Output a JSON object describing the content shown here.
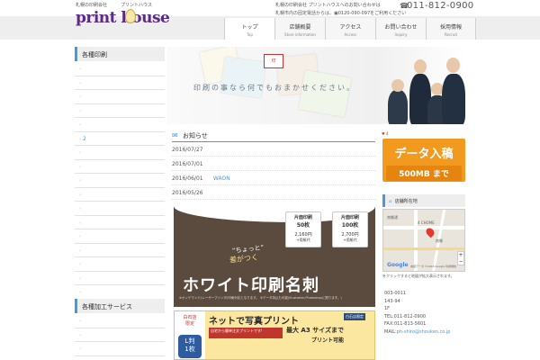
{
  "header": {
    "logo_tagline": "札幌の印刷会社",
    "logo_kana": "プリントハウス",
    "logo_text": "print house",
    "contact_line1": "札幌の印刷会社 プリントハウスへのお問い合わせは",
    "tel_icon": "☎",
    "tel_number": "011-812-0900",
    "contact_line2": "札幌市内の固定電話からは、▣0120-090-097をご利用ください"
  },
  "nav": [
    {
      "jp": "トップ",
      "en": "Top"
    },
    {
      "jp": "店舗概要",
      "en": "Store information"
    },
    {
      "jp": "アクセス",
      "en": "Access"
    },
    {
      "jp": "お問い合わせ",
      "en": "Inquiry"
    },
    {
      "jp": "採用情報",
      "en": "Recruit"
    }
  ],
  "sidebar": {
    "heading1": "各種印刷",
    "items1": [
      "",
      "",
      "",
      "",
      "",
      "2",
      "",
      "",
      "",
      "",
      "",
      "",
      "",
      "",
      "",
      "",
      "",
      ""
    ],
    "heading2": "各種加工サービス",
    "chevron": "›"
  },
  "hero": {
    "stamp_text": "印",
    "tagline": "印刷の事なら何でもおまかせください。"
  },
  "news": {
    "icon": "✉",
    "title": "お知らせ",
    "rows": [
      {
        "date": "2016/07/27",
        "text": ""
      },
      {
        "date": "2016/07/01",
        "text": ""
      },
      {
        "date": "2016/06/01",
        "text": "WAON"
      },
      {
        "date": "2016/05/26",
        "text": ""
      }
    ]
  },
  "banner1": {
    "price1_label": "片面印刷",
    "price1_qty": "50枚",
    "price1_price": "2,160円",
    "price1_sub": "+用紙代",
    "price2_label": "片面印刷",
    "price2_qty": "100枚",
    "price2_price": "2,700円",
    "price2_sub": "+用紙代",
    "small1": "“ちょっと”",
    "small2": "差がつく",
    "main": "ホワイト印刷名刺",
    "note": "※オンデマンド(レーザープリンタ)印刷対応となります。 ※データ持込も可能(Illustrator,Photoshopに限ります。)"
  },
  "banner2": {
    "tag_line1": "白石店",
    "tag_line2": "限定",
    "title": "ネットで写真プリント",
    "badge": "白石店限定",
    "strip": "自宅から簡単注文プリントです!",
    "big": "最大 A3 サイズまで",
    "sub": "プリント可能",
    "left_line1": "L判",
    "left_line2": "1枚"
  },
  "right": {
    "fb": "♥ 4",
    "data_title": "データ入稿",
    "data_sub": "500MB まで",
    "map_head_icon": "⌂",
    "map_head": "店舗所在地",
    "map_label1": "南郷通",
    "map_label2": "4 CHOME",
    "map_label3": "南郷",
    "google": "Google",
    "map_terms": "地図データ ©2016 Google  利用規約",
    "zoom": "+ −",
    "map_note": "をクリックすると地図が拡大表示されます。",
    "address": [
      "003-0011",
      "143-94",
      "1F",
      "TEL:011-812-0900",
      "FAX:011-813-5601"
    ],
    "mail_label": "MAIL:",
    "mail": "ph-shiro@shouken.co.jp"
  },
  "colors": {
    "brand_purple": "#5b2a86",
    "accent_blue": "#4a9ad4",
    "orange": "#f29a1f"
  }
}
